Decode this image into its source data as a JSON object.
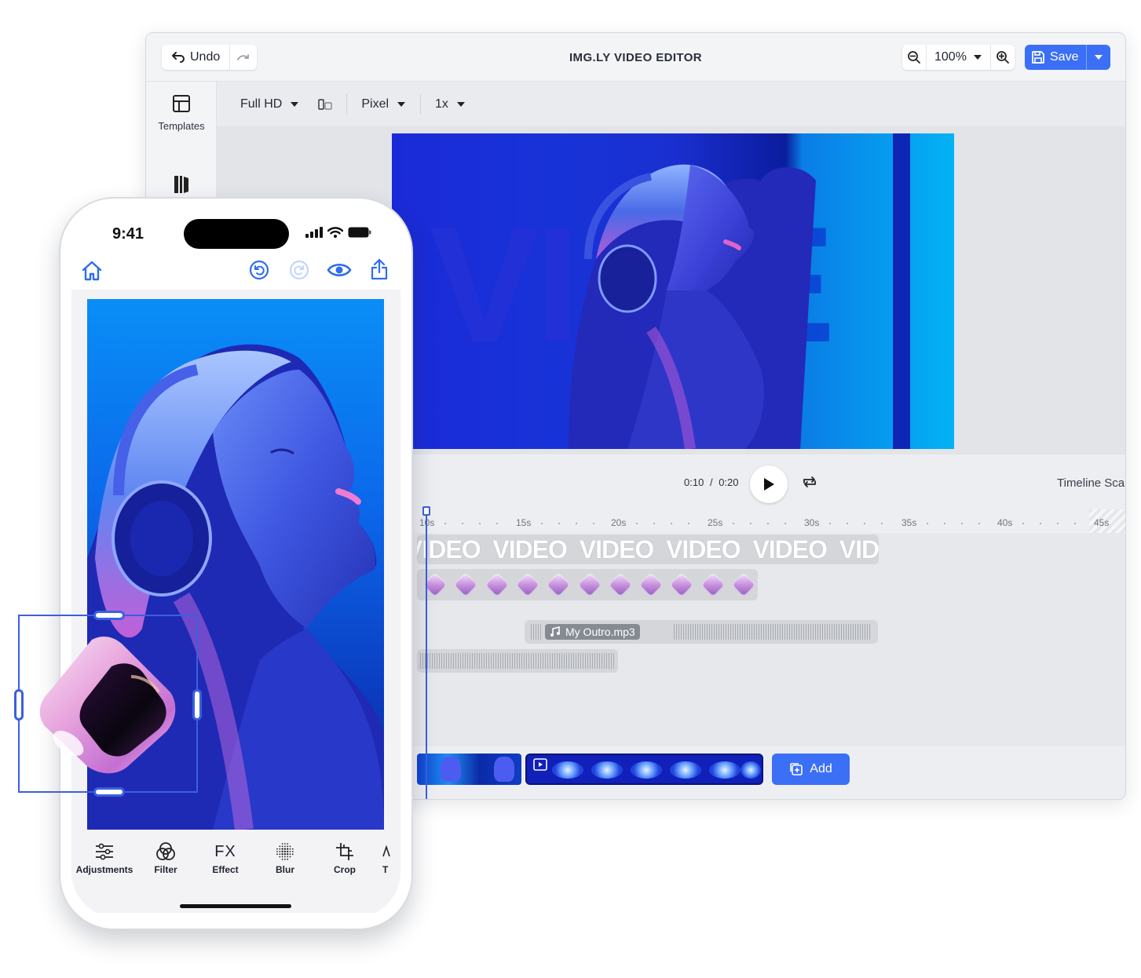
{
  "editor": {
    "title": "IMG.LY VIDEO EDITOR",
    "undo_label": "Undo",
    "zoom_value": "100%",
    "save_label": "Save",
    "sidebar": {
      "templates_label": "Templates"
    },
    "toolbar": {
      "format": "Full HD",
      "unit": "Pixel",
      "scale": "1x"
    },
    "canvas": {
      "overlay_text": [
        "VI",
        "E"
      ]
    },
    "playback": {
      "current": "0:10",
      "separator": "/",
      "total": "0:20",
      "timeline_scale_label": "Timeline Sca"
    },
    "ruler": [
      "10s",
      "15s",
      "20s",
      "25s",
      "30s",
      "35s",
      "40s",
      "45s"
    ],
    "tracks": {
      "text_clip": "VIDEO  VIDEO  VIDEO  VIDEO  VIDEO  VIDE",
      "audio_clip_name": "My Outro.mp3"
    },
    "add_label": "Add",
    "accent_color": "#3b6ff5"
  },
  "phone": {
    "status_time": "9:41",
    "tools": [
      {
        "label": "Adjustments",
        "icon": "sliders-icon"
      },
      {
        "label": "Filter",
        "icon": "filter-icon"
      },
      {
        "label": "Effect",
        "icon": "fx-icon"
      },
      {
        "label": "Blur",
        "icon": "blur-icon"
      },
      {
        "label": "Crop",
        "icon": "crop-icon"
      }
    ],
    "tools_partial_letter": "T",
    "fx_glyph": "FX"
  }
}
